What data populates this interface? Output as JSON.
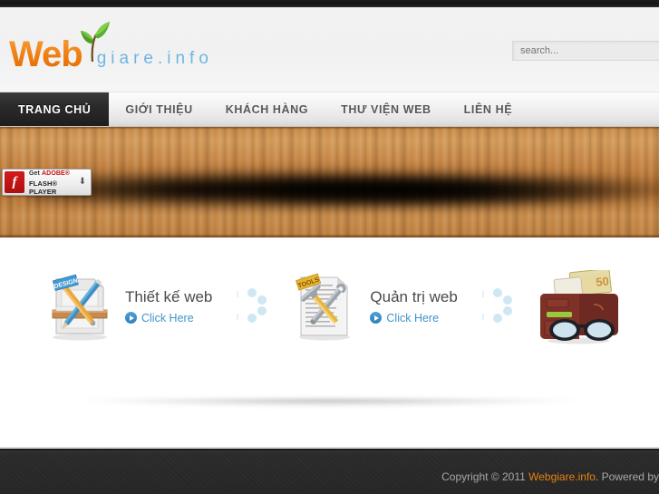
{
  "site": {
    "logo_text": "Web",
    "logo_domain": "giare.info",
    "leaf_icon": "leaf-icon"
  },
  "search": {
    "placeholder": "search...",
    "value": ""
  },
  "nav": {
    "items": [
      {
        "label": "TRANG CHỦ",
        "active": true
      },
      {
        "label": "GIỚI THIỆU",
        "active": false
      },
      {
        "label": "KHÁCH HÀNG",
        "active": false
      },
      {
        "label": "THƯ VIỆN WEB",
        "active": false
      },
      {
        "label": "LIÊN HỆ",
        "active": false
      }
    ]
  },
  "banner": {
    "flash_badge": {
      "line1_prefix": "Get ",
      "line1_brand": "ADOBE®",
      "line2": "FLASH® PLAYER",
      "download_icon": "download-arrow-icon"
    }
  },
  "services": [
    {
      "title": "Thiết kế web",
      "link_label": "Click Here",
      "icon": "design-board-icon",
      "tag": "DESIGN"
    },
    {
      "title": "Quản trị web",
      "link_label": "Click Here",
      "icon": "document-tools-icon",
      "tag": "TOOLS"
    },
    {
      "title": "",
      "link_label": "",
      "icon": "wallet-glasses-icon",
      "tag": ""
    }
  ],
  "footer": {
    "copyright_prefix": "Copyright © 2011 ",
    "brand": "Webgiare.info",
    "copyright_suffix": ". Powered by"
  },
  "colors": {
    "brand_orange": "#ef7d10",
    "brand_blue": "#6cb6e4",
    "link_blue": "#3f93c8",
    "nav_active_bg": "#1e1e1e",
    "footer_bg": "#262626",
    "wood": "#c17e3c"
  }
}
